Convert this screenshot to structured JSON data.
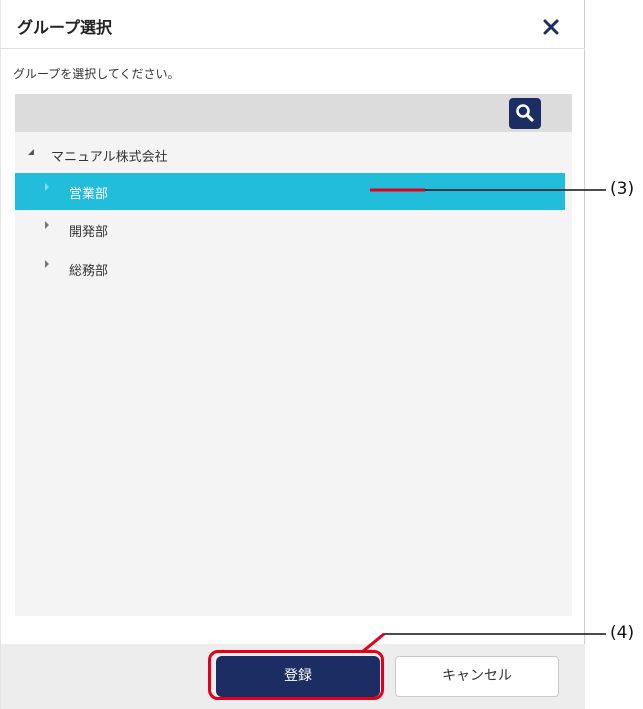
{
  "dialog": {
    "title": "グループ選択",
    "instruction": "グループを選択してください。"
  },
  "search": {
    "button_icon": "search-icon"
  },
  "tree": {
    "root": {
      "label": "マニュアル株式会社",
      "expanded": true
    },
    "children": [
      {
        "label": "営業部",
        "selected": true
      },
      {
        "label": "開発部",
        "selected": false
      },
      {
        "label": "総務部",
        "selected": false
      }
    ]
  },
  "footer": {
    "register_label": "登録",
    "cancel_label": "キャンセル"
  },
  "annotations": {
    "callout_3": "(3)",
    "callout_4": "(4)"
  },
  "colors": {
    "primary": "#1b2d63",
    "selected_row": "#23bddc",
    "highlight": "#e4001b"
  }
}
